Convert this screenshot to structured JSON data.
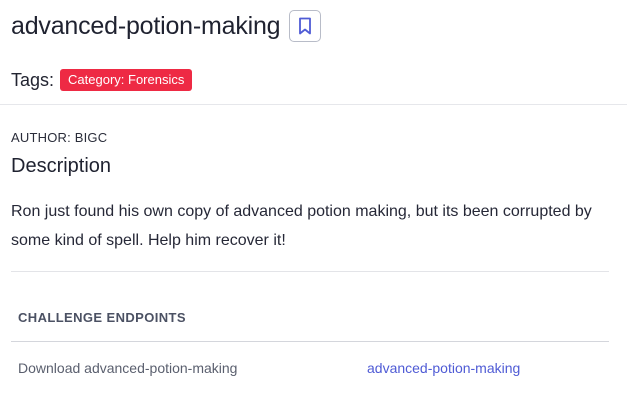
{
  "challenge": {
    "title": "advanced-potion-making",
    "bookmark_icon": "bookmark-icon",
    "tags_label": "Tags:",
    "tags": [
      {
        "label": "Category: Forensics",
        "color": "#ee2a44"
      }
    ],
    "author": "AUTHOR: BIGC",
    "description_heading": "Description",
    "description": "Ron just found his own copy of advanced potion making, but its been corrupted by some kind of spell. Help him recover it!"
  },
  "endpoints": {
    "heading": "CHALLENGE ENDPOINTS",
    "rows": [
      {
        "name": "Download advanced-potion-making",
        "link_label": "advanced-potion-making"
      }
    ]
  },
  "colors": {
    "accent_link": "#4f5bd5",
    "tag_red": "#ee2a44",
    "bookmark_icon": "#4f5bd5"
  }
}
